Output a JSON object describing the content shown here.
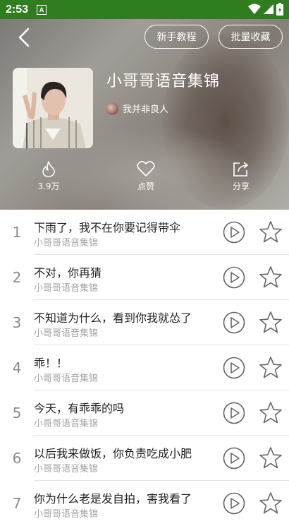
{
  "status_bar": {
    "time": "2:53",
    "notif_letter": "A"
  },
  "header": {
    "tutorial_label": "新手教程",
    "collect_label": "批量收藏",
    "album_title": "小哥哥语音集锦",
    "author": "我并非良人"
  },
  "stats": {
    "hot_value": "3.9万",
    "like_label": "点赞",
    "share_label": "分享"
  },
  "tracks": [
    {
      "num": "1",
      "title": "下雨了，我不在你要记得带伞",
      "sub": "小哥哥语音集锦"
    },
    {
      "num": "2",
      "title": "不对，你再猜",
      "sub": "小哥哥语音集锦"
    },
    {
      "num": "3",
      "title": "不知道为什么，看到你我就怂了",
      "sub": "小哥哥语音集锦"
    },
    {
      "num": "4",
      "title": "乖！！",
      "sub": "小哥哥语音集锦"
    },
    {
      "num": "5",
      "title": "今天，有乖乖的吗",
      "sub": "小哥哥语音集锦"
    },
    {
      "num": "6",
      "title": "以后我来做饭，你负责吃成小肥",
      "sub": "小哥哥语音集锦"
    },
    {
      "num": "7",
      "title": "你为什么老是发自拍，害我看了",
      "sub": "小哥哥语音集锦"
    }
  ],
  "colors": {
    "status_bar": "#2f7d1f",
    "icon_gray": "#666666"
  }
}
